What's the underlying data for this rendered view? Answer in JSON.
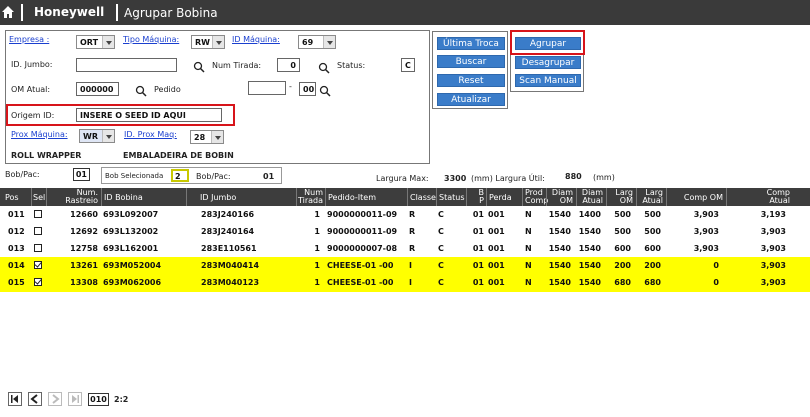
{
  "header": {
    "brand": "Honeywell",
    "title": "Agrupar Bobina"
  },
  "filters": {
    "empresa_label": "Empresa :",
    "empresa_value": "ORT",
    "tipo_maquina_label": "Tipo Máquina:",
    "tipo_maquina_value": "RW",
    "id_maquina_label": "ID Máquina:",
    "id_maquina_value": "69",
    "id_jumbo_label": "ID. Jumbo:",
    "id_jumbo_value": "",
    "num_tirada_label": "Num Tirada:",
    "num_tirada_value": "0",
    "status_label": "Status:",
    "status_value": "C",
    "om_atual_label": "OM Atual:",
    "om_atual_value": "000000",
    "pedido_label": "Pedido",
    "pedido_value": "",
    "pedido_dash": "-",
    "pedido_suffix": "00",
    "origem_id_label": "Origem ID:",
    "origem_id_value": "INSERE O SEED ID AQUI",
    "prox_maquina_label": "Prox Máquina:",
    "prox_maquina_value": "WR",
    "id_prox_maq_label": "ID. Prox Maq:",
    "id_prox_maq_value": "28",
    "prox_maquina_desc": "ROLL WRAPPER",
    "id_prox_maq_desc": "EMBALADEIRA DE BOBIN"
  },
  "buttons": {
    "ultima_troca": "Última Troca",
    "buscar": "Buscar",
    "reset": "Reset",
    "atualizar": "Atualizar",
    "agrupar": "Agrupar",
    "desagrupar": "Desagrupar",
    "scan_manual": "Scan Manual"
  },
  "info": {
    "bob_pac_label": "Bob/Pac:",
    "bob_pac_value": "01",
    "bob_selecionada_label": "Bob Selecionada",
    "bob_selecionada_value": "2",
    "bob_pac2_label": "Bob/Pac:",
    "bob_pac2_value": "01",
    "largura_max_label": "Largura Max:",
    "largura_max_value": "3300",
    "largura_util_label": "(mm) Largura Útil:",
    "largura_util_value": "880",
    "mm": "(mm)"
  },
  "table": {
    "headers": {
      "pos": "Pos",
      "sel": "Sel",
      "num_rastreio_1": "Num.",
      "num_rastreio_2": "Rastreio",
      "id_bobina": "ID Bobina",
      "id_jumbo": "ID Jumbo",
      "num_tirada_1": "Num",
      "num_tirada_2": "Tirada",
      "pedido_item": "Pedido-Item",
      "classe": "Classe",
      "status": "Status",
      "bp_1": "B",
      "bp_2": "P",
      "perda": "Perda",
      "prod_comp_1": "Prod",
      "prod_comp_2": "Comp",
      "diam_om_1": "Diam",
      "diam_om_2": "OM",
      "diam_atual_1": "Diam",
      "diam_atual_2": "Atual",
      "larg_om_1": "Larg",
      "larg_om_2": "OM",
      "larg_atual_1": "Larg",
      "larg_atual_2": "Atual",
      "comp_om": "Comp OM",
      "comp_atual_1": "Comp",
      "comp_atual_2": "Atual"
    },
    "rows": [
      {
        "pos": "011",
        "sel": false,
        "rastreio": "12660",
        "bobina": "693L092007",
        "jumbo": "283J240166",
        "tirada": "1",
        "pedido": "9000000011-09",
        "classe": "R",
        "status": "C",
        "bp": "01",
        "perda": "001",
        "prod": "N",
        "diam_om": "1540",
        "diam_atual": "1400",
        "larg_om": "500",
        "larg_atual": "500",
        "comp_om": "3,903",
        "comp_atual": "3,193"
      },
      {
        "pos": "012",
        "sel": false,
        "rastreio": "12692",
        "bobina": "693L132002",
        "jumbo": "283J240164",
        "tirada": "1",
        "pedido": "9000000011-09",
        "classe": "R",
        "status": "C",
        "bp": "01",
        "perda": "001",
        "prod": "N",
        "diam_om": "1540",
        "diam_atual": "1540",
        "larg_om": "500",
        "larg_atual": "500",
        "comp_om": "3,903",
        "comp_atual": "3,903"
      },
      {
        "pos": "013",
        "sel": false,
        "rastreio": "12758",
        "bobina": "693L162001",
        "jumbo": "283E110561",
        "tirada": "1",
        "pedido": "9000000007-08",
        "classe": "R",
        "status": "C",
        "bp": "01",
        "perda": "001",
        "prod": "N",
        "diam_om": "1540",
        "diam_atual": "1540",
        "larg_om": "600",
        "larg_atual": "600",
        "comp_om": "3,903",
        "comp_atual": "3,903"
      },
      {
        "pos": "014",
        "sel": true,
        "rastreio": "13261",
        "bobina": "693M052004",
        "jumbo": "283M040414",
        "tirada": "1",
        "pedido": "CHEESE-01 -00",
        "classe": "I",
        "status": "C",
        "bp": "01",
        "perda": "001",
        "prod": "N",
        "diam_om": "1540",
        "diam_atual": "1540",
        "larg_om": "200",
        "larg_atual": "200",
        "comp_om": "0",
        "comp_atual": "3,903"
      },
      {
        "pos": "015",
        "sel": true,
        "rastreio": "13308",
        "bobina": "693M062006",
        "jumbo": "283M040123",
        "tirada": "1",
        "pedido": "CHEESE-01 -00",
        "classe": "I",
        "status": "C",
        "bp": "01",
        "perda": "001",
        "prod": "N",
        "diam_om": "1540",
        "diam_atual": "1540",
        "larg_om": "680",
        "larg_atual": "680",
        "comp_om": "0",
        "comp_atual": "3,903"
      }
    ]
  },
  "pager": {
    "page_value": "010",
    "page_info": "2:2"
  }
}
